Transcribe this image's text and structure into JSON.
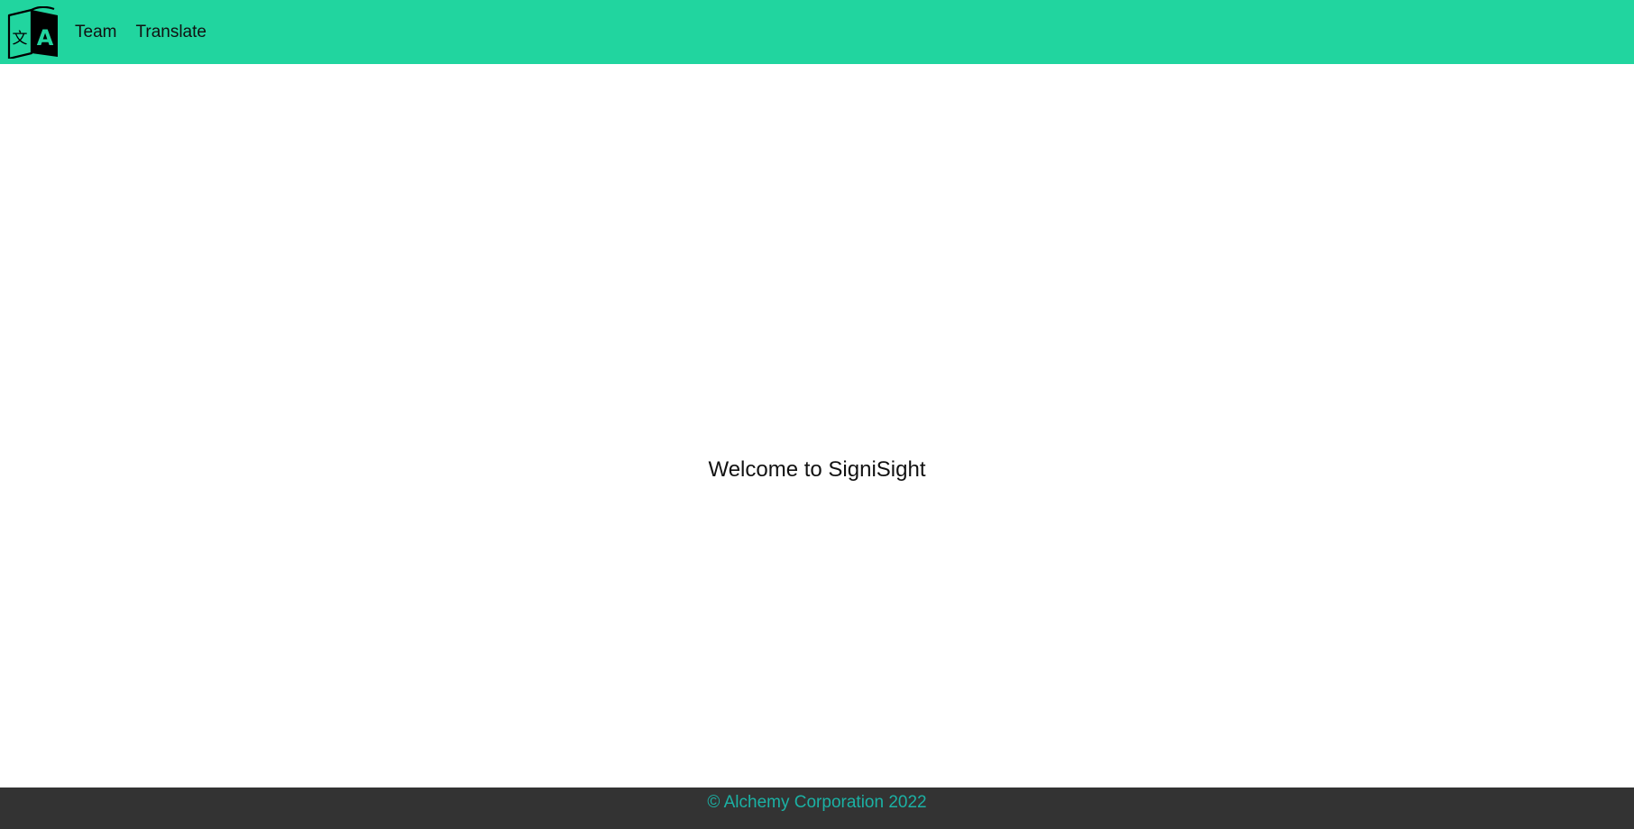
{
  "navbar": {
    "logo_icon": "translate-logo-icon",
    "links": [
      {
        "label": "Team"
      },
      {
        "label": "Translate"
      }
    ],
    "background_color": "#21d59f"
  },
  "main": {
    "welcome_text": "Welcome to SigniSight"
  },
  "footer": {
    "copyright": "© Alchemy Corporation 2022",
    "background_color": "#333333",
    "text_color": "#1bb1a4"
  }
}
